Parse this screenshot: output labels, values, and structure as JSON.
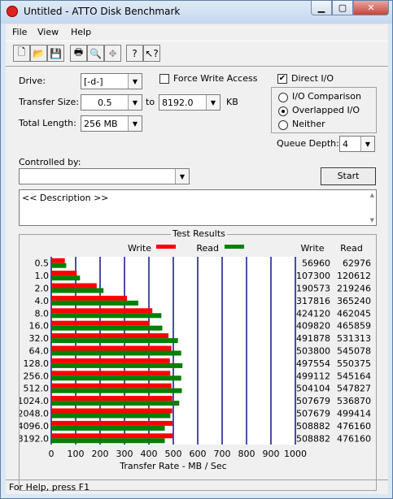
{
  "window": {
    "title": "Untitled - ATTO Disk Benchmark"
  },
  "menu": [
    "File",
    "View",
    "Help"
  ],
  "toolbar_icons": [
    "new-icon",
    "open-icon",
    "save-icon",
    "print-icon",
    "print-preview-icon",
    "move-icon",
    "help-icon",
    "context-help-icon"
  ],
  "form": {
    "drive_label": "Drive:",
    "drive_value": "[-d-]",
    "force_write_label": "Force Write Access",
    "direct_io_label": "Direct I/O",
    "transfer_size_label": "Transfer Size:",
    "transfer_from": "0.5",
    "to_label": "to",
    "transfer_to": "8192.0",
    "kb_label": "KB",
    "total_length_label": "Total Length:",
    "total_length_value": "256 MB",
    "io_comparison_label": "I/O Comparison",
    "overlapped_io_label": "Overlapped I/O",
    "neither_label": "Neither",
    "queue_depth_label": "Queue Depth:",
    "queue_depth_value": "4",
    "controlled_by_label": "Controlled by:",
    "controlled_by_value": "",
    "start_label": "Start",
    "description_text": "<< Description >>"
  },
  "results": {
    "title": "Test Results",
    "write_legend": "Write",
    "read_legend": "Read",
    "write_header": "Write",
    "read_header": "Read",
    "write_color": "#ff0000",
    "read_color": "#008000"
  },
  "status": {
    "text": "For Help, press F1"
  },
  "chart_data": {
    "type": "bar",
    "orientation": "horizontal",
    "categories": [
      "0.5",
      "1.0",
      "2.0",
      "4.0",
      "8.0",
      "16.0",
      "32.0",
      "64.0",
      "128.0",
      "256.0",
      "512.0",
      "1024.0",
      "2048.0",
      "4096.0",
      "8192.0"
    ],
    "series": [
      {
        "name": "Write",
        "values": [
          56960,
          107300,
          190573,
          317816,
          424120,
          409820,
          491878,
          503800,
          497554,
          499112,
          504104,
          507679,
          507679,
          508882,
          508882
        ]
      },
      {
        "name": "Read",
        "values": [
          62976,
          120612,
          219246,
          365240,
          462045,
          465859,
          531313,
          545078,
          550375,
          545164,
          547827,
          536870,
          499414,
          476160,
          476160
        ]
      }
    ],
    "xlabel": "Transfer Rate - MB / Sec",
    "x_ticks": [
      "0",
      "100",
      "200",
      "300",
      "400",
      "500",
      "600",
      "700",
      "800",
      "900",
      "1000"
    ],
    "xlim": [
      0,
      1000
    ],
    "legend": "top",
    "grid": true
  }
}
